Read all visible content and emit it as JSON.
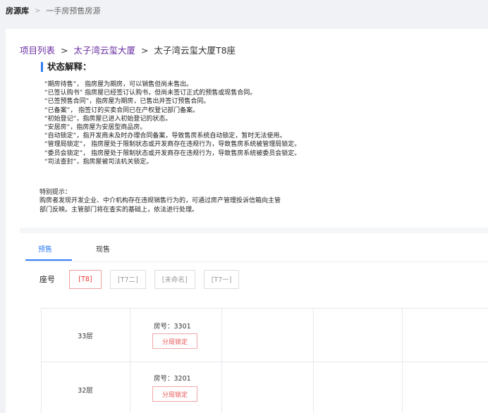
{
  "topbar": {
    "root": "房源库",
    "separator": ">",
    "current": "一手房预售房源"
  },
  "project_breadcrumb": {
    "items": [
      "项目列表",
      "太子湾云玺大厦",
      "太子湾云玺大厦T8座"
    ],
    "separator": ">"
  },
  "status_section": {
    "title": "状态解释：",
    "lines": [
      "“期房待售”，  指房屋为期房，可以销售但尚未售出。",
      "“已签认购书”  指房屋已经签订认购书，但尚未签订正式的预售或现售合同。",
      "“已签预售合同”，指房屋为期房，已售出并签订预售合同。",
      "“已备案”，  指签订的买卖合同已在产权登记部门备案。",
      "“初始登记”，指房屋已进入初始登记的状态。",
      "“安居房”，指房屋为安居型商品房。",
      "“自动锁定”，指开发商未及时办理合同备案，导致售房系统自动锁定，暂时无法使用。",
      "“管理局锁定”，  指房屋处于限制状态或开发商存在违规行为，导致售房系统被管理局锁定。",
      "“委员会锁定”，  指房屋处于限制状态或开发商存在违规行为，导致售房系统被委员会锁定。",
      "“司法查封”，指房屋被司法机关锁定。"
    ]
  },
  "note": {
    "heading": "特别提示：",
    "line1": "购房者发现开发企业、中介机构存在违规销售行为的，可通过房产管理投诉信箱向主管",
    "line2": "部门反映。主管部门将在查实的基础上，依法进行处理。"
  },
  "tabs": {
    "presale": "预售",
    "current": "现售",
    "active": "presale"
  },
  "seat": {
    "label": "座号",
    "options": [
      "[T8]",
      "[T7二]",
      "[未命名]",
      "[T7一]"
    ],
    "active_index": 0
  },
  "floors": [
    {
      "floor": "33层",
      "room": "房号：3301",
      "status": "分局锁定"
    },
    {
      "floor": "32层",
      "room": "房号：3201",
      "status": "分局锁定"
    }
  ],
  "colors": {
    "accent": "#2f7cf6",
    "link": "#6b2fa3",
    "lock": "#e85555"
  }
}
